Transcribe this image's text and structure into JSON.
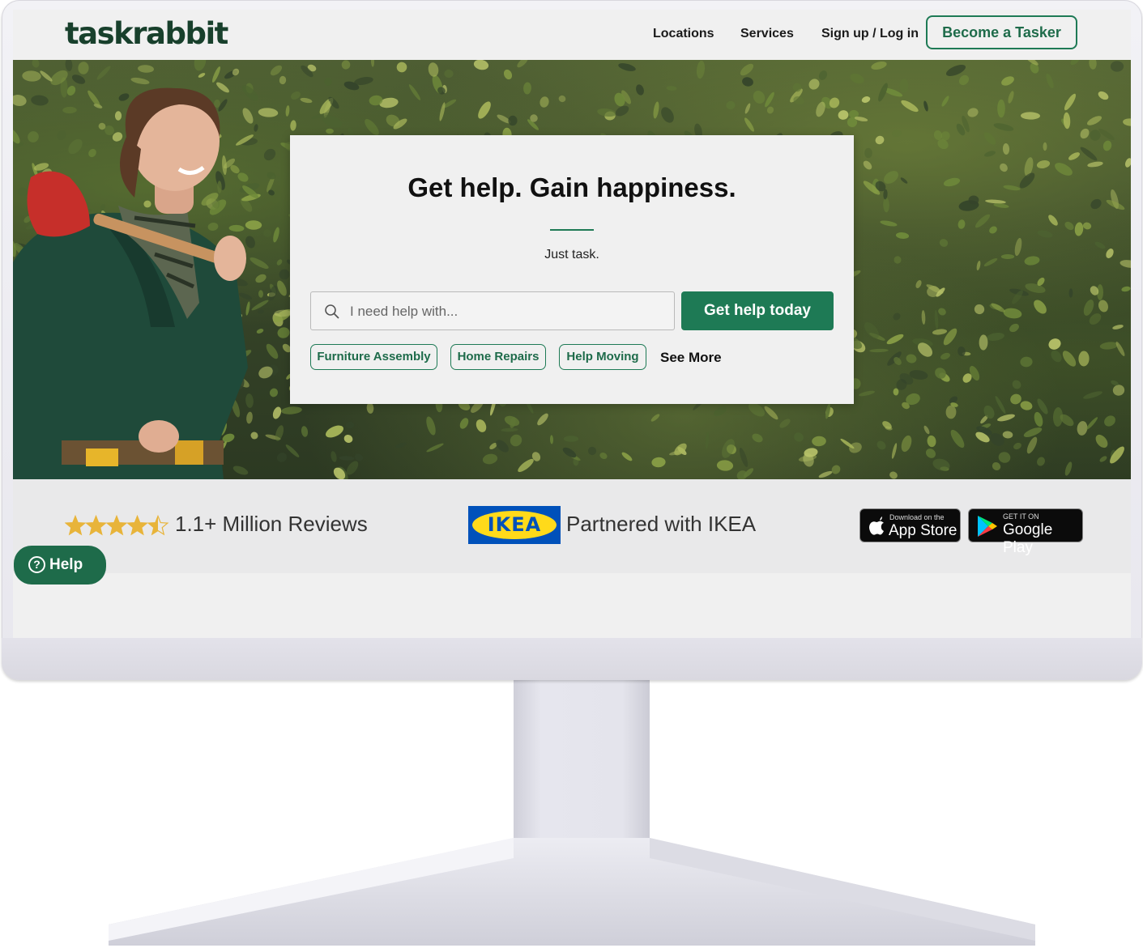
{
  "header": {
    "logo": "taskrabbit",
    "nav": {
      "locations": "Locations",
      "services": "Services",
      "signup_login": "Sign up / Log in"
    },
    "become_tasker": "Become a Tasker"
  },
  "hero": {
    "headline": "Get help. Gain happiness.",
    "tagline": "Just task.",
    "search": {
      "placeholder": "I need help with..."
    },
    "cta": "Get help today",
    "chips": [
      "Furniture Assembly",
      "Home Repairs",
      "Help Moving"
    ],
    "see_more": "See More"
  },
  "trust": {
    "rating_stars": 4.5,
    "reviews": "1.1+ Million Reviews",
    "ikea_logo": "IKEA",
    "partner": "Partnered with IKEA",
    "app_store": {
      "small": "Download on the",
      "big": "App Store"
    },
    "google_play": {
      "small": "GET IT ON",
      "big": "Google Play"
    }
  },
  "help_button": "Help",
  "colors": {
    "brand_green": "#1e7a55",
    "dark_green": "#18402c",
    "star_gold": "#e8b43a",
    "ikea_blue": "#0051ba",
    "ikea_yellow": "#ffda1a"
  }
}
